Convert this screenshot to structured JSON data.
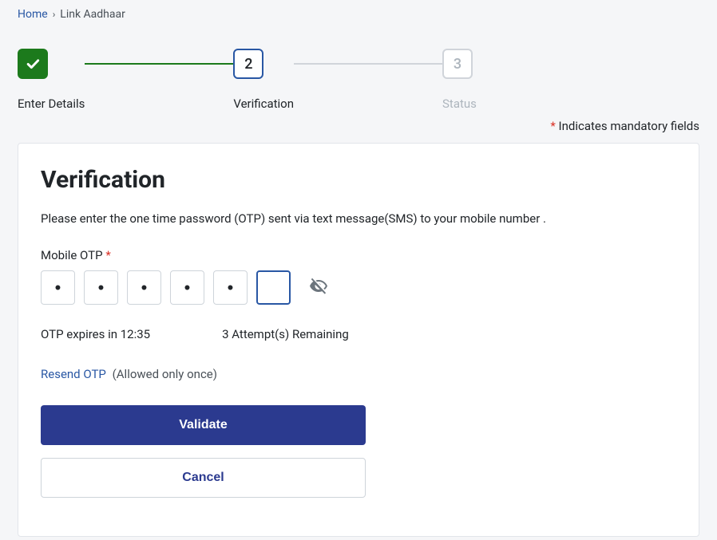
{
  "breadcrumb": {
    "home": "Home",
    "current": "Link Aadhaar"
  },
  "stepper": {
    "step1_label": "Enter Details",
    "step2_number": "2",
    "step2_label": "Verification",
    "step3_number": "3",
    "step3_label": "Status"
  },
  "mandatory_note": "Indicates mandatory fields",
  "card": {
    "title": "Verification",
    "instruction": "Please enter the one time password (OTP) sent via text message(SMS) to your mobile number .",
    "otp_label": "Mobile OTP",
    "otp_values": [
      "•",
      "•",
      "•",
      "•",
      "•",
      ""
    ],
    "otp_active_cursor": "|",
    "expires_prefix": "OTP expires in ",
    "expires_time": "12:35",
    "attempts_text": "3 Attempt(s) Remaining",
    "resend_link": "Resend OTP",
    "resend_note": "(Allowed only once)",
    "validate_btn": "Validate",
    "cancel_btn": "Cancel"
  }
}
